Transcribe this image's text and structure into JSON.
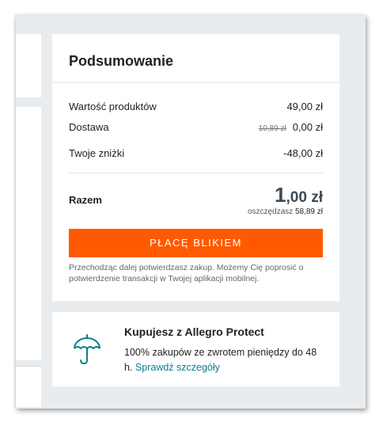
{
  "summary": {
    "title": "Podsumowanie",
    "products_label": "Wartość produktów",
    "products_value": "49,00 zł",
    "delivery_label": "Dostawa",
    "delivery_old_value": "10,89 zł",
    "delivery_value": "0,00 zł",
    "discounts_label": "Twoje zniżki",
    "discounts_value": "-48,00 zł",
    "total_label": "Razem",
    "total_int": "1",
    "total_frac": ",00 zł",
    "savings_label": "oszczędzasz",
    "savings_value": "58,89 zł",
    "pay_button_label": "PŁACĘ BLIKIEM",
    "disclaimer": "Przechodząc dalej potwierdzasz zakup. Możemy Cię poprosić o potwierdzenie transakcji w Twojej aplikacji mobilnej."
  },
  "protect": {
    "title": "Kupujesz z Allegro Protect",
    "text": "100% zakupów ze zwrotem pieniędzy do 48 h.",
    "link_label": "Sprawdź szczegóły",
    "icon": "umbrella-icon"
  },
  "colors": {
    "background": "#e9ecee",
    "accent_button": "#ff5a00",
    "link": "#0a7f8a",
    "total": "#3b4a54"
  }
}
